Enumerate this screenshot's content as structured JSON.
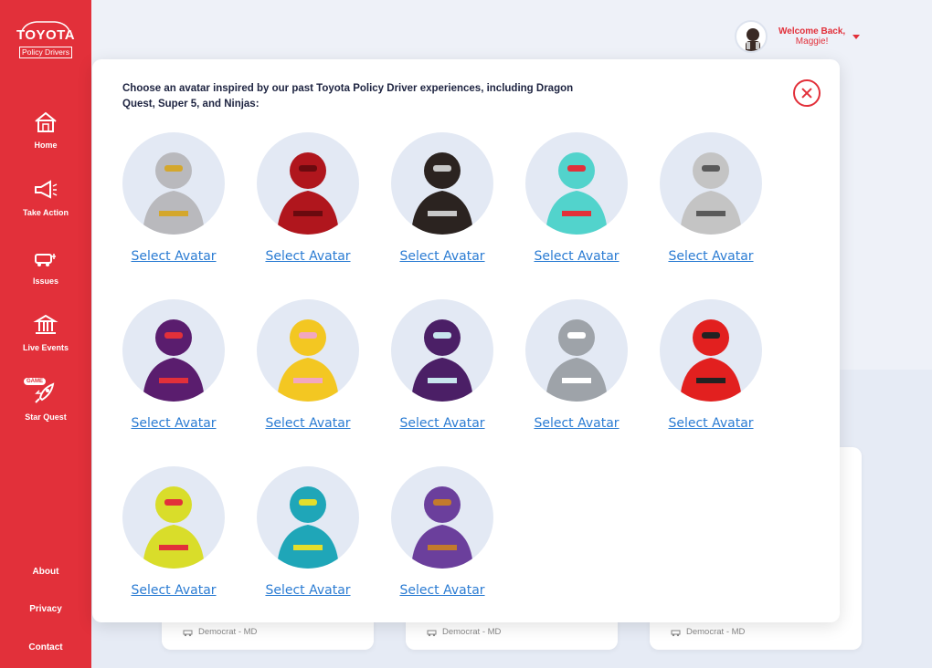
{
  "brand": {
    "name": "TOYOTA",
    "sub": "Policy Drivers"
  },
  "nav": [
    {
      "key": "home",
      "label": "Home"
    },
    {
      "key": "take-action",
      "label": "Take Action"
    },
    {
      "key": "issues",
      "label": "Issues"
    },
    {
      "key": "live-events",
      "label": "Live Events"
    },
    {
      "key": "star-quest",
      "label": "Star Quest",
      "badge": "GAME"
    }
  ],
  "footer_links": [
    "About",
    "Privacy",
    "Contact"
  ],
  "user": {
    "welcome": "Welcome Back,",
    "name": "Maggie!"
  },
  "modal": {
    "title": "Choose an avatar inspired by our past Toyota Policy Driver experiences, including Dragon Quest, Super 5, and Ninjas:",
    "select_label": "Select Avatar",
    "avatars": [
      {
        "name": "knight-avatar",
        "color": "#b9b9bd",
        "accent": "#d4a72c"
      },
      {
        "name": "dragon-avatar",
        "color": "#b0161d",
        "accent": "#6a0a0f"
      },
      {
        "name": "warrior-avatar",
        "color": "#2b2320",
        "accent": "#c8c8c8"
      },
      {
        "name": "teal-hero-avatar",
        "color": "#52d3cc",
        "accent": "#e2303a"
      },
      {
        "name": "stone-golem-avatar",
        "color": "#c4c4c4",
        "accent": "#5a5a5a"
      },
      {
        "name": "purple-mage-avatar",
        "color": "#5a1d6e",
        "accent": "#e2303a"
      },
      {
        "name": "brain-robot-avatar",
        "color": "#f3c722",
        "accent": "#f2a7c0"
      },
      {
        "name": "crystal-villain-avatar",
        "color": "#4b1f66",
        "accent": "#c8e6ee"
      },
      {
        "name": "gray-ninja-avatar",
        "color": "#9ea3a9",
        "accent": "#ffffff"
      },
      {
        "name": "red-ninja-avatar",
        "color": "#e2201f",
        "accent": "#222222"
      },
      {
        "name": "yellow-ninja-avatar",
        "color": "#d9dd2a",
        "accent": "#e2303a"
      },
      {
        "name": "teal-ninja-avatar",
        "color": "#1fa6b8",
        "accent": "#e4de2a"
      },
      {
        "name": "purple-ninja-avatar",
        "color": "#6b3f9c",
        "accent": "#c37a2c"
      }
    ]
  },
  "background_cards": [
    {
      "party": "Democrat - MD"
    },
    {
      "party": "Democrat - MD"
    },
    {
      "party": "Democrat - MD"
    }
  ],
  "colors": {
    "primary": "#e2303a",
    "link": "#2b7cd3",
    "title": "#1d2340"
  }
}
